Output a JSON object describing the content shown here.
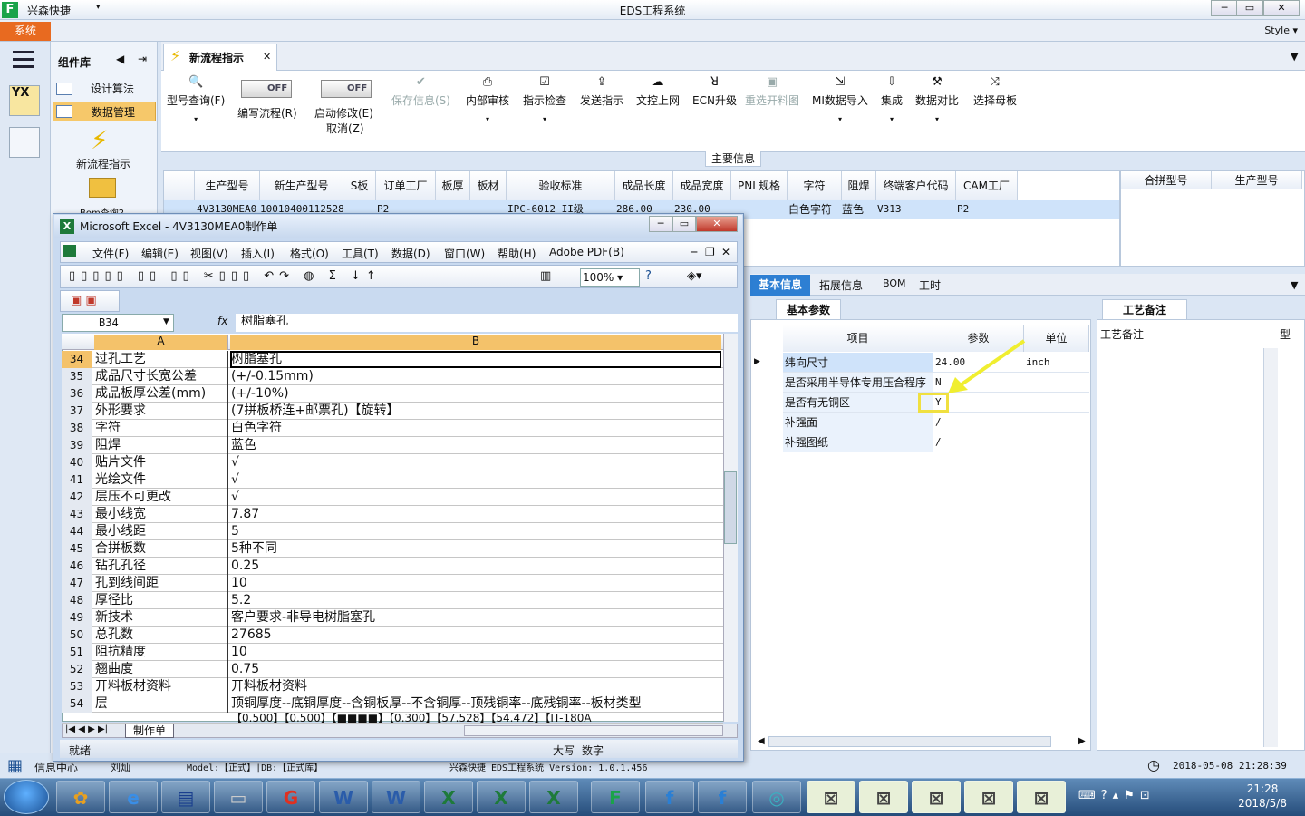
{
  "app": {
    "name": "兴森快捷",
    "window_title": "EDS工程系统",
    "system_menu": "系统",
    "style_label": "Style"
  },
  "component_panel": {
    "title": "组件库",
    "items": [
      {
        "label": "设计算法"
      },
      {
        "label": "数据管理"
      }
    ],
    "new_flow_label": "新流程指示",
    "bom_label": "Bom查询2"
  },
  "main_tab": {
    "label": "新流程指示"
  },
  "ribbon": {
    "buttons": [
      {
        "label": "型号查询(F)",
        "icon": "search-icon"
      },
      {
        "label": "编写流程(R)",
        "toggle": "OFF"
      },
      {
        "label": "启动修改(E)",
        "toggle": "OFF",
        "sub": "取消(Z)"
      },
      {
        "label": "保存信息(S)",
        "icon": "check-icon",
        "disabled": true
      },
      {
        "label": "内部审核",
        "icon": "print-icon"
      },
      {
        "label": "指示检查",
        "icon": "check-square-icon"
      },
      {
        "label": "发送指示",
        "icon": "upload-icon"
      },
      {
        "label": "文控上网",
        "icon": "cloud-upload-icon"
      },
      {
        "label": "ECN升级",
        "icon": "ecn-icon"
      },
      {
        "label": "重选开料图",
        "icon": "image-icon",
        "disabled": true
      },
      {
        "label": "MI数据导入",
        "icon": "import-icon"
      },
      {
        "label": "集成",
        "icon": "download-icon"
      },
      {
        "label": "数据对比",
        "icon": "compare-icon"
      },
      {
        "label": "选择母板",
        "icon": "shuffle-icon"
      }
    ],
    "section_label": "主要信息"
  },
  "main_grid": {
    "columns": [
      "生产型号",
      "新生产型号",
      "S板",
      "订单工厂",
      "板厚",
      "板材",
      "验收标准",
      "成品长度",
      "成品宽度",
      "PNL规格",
      "字符",
      "阻焊",
      "终端客户代码",
      "CAM工厂"
    ],
    "row": [
      "4V3130MEA0",
      "10010400112528",
      "P2",
      "",
      "",
      "",
      "IPC-6012 II级",
      "286.00",
      "230.00",
      "",
      "白色字符",
      "蓝色",
      "V313",
      "P2"
    ]
  },
  "side_grid": {
    "columns": [
      "合拼型号",
      "生产型号"
    ]
  },
  "lower_tabs": [
    "基本信息",
    "拓展信息",
    "BOM",
    "工时"
  ],
  "basic_params": {
    "tab_label": "基本参数",
    "columns": [
      "项目",
      "参数",
      "单位"
    ],
    "rows": [
      {
        "item": "纬向尺寸",
        "value": "24.00",
        "unit": "inch"
      },
      {
        "item": "是否采用半导体专用压合程序",
        "value": "N",
        "unit": ""
      },
      {
        "item": "是否有无铜区",
        "value": "Y",
        "unit": ""
      },
      {
        "item": "补强面",
        "value": "/",
        "unit": ""
      },
      {
        "item": "补强图纸",
        "value": "/",
        "unit": ""
      }
    ]
  },
  "process_notes": {
    "tab_label": "工艺备注",
    "column": "工艺备注",
    "column2": "型"
  },
  "status_bar": {
    "left": "信息中心",
    "user": "刘灿",
    "model": "Model:【正式】|DB:【正式库】",
    "center": "兴森快捷 EDS工程系统 Version: 1.0.1.456",
    "datetime": "2018-05-08 21:28:39"
  },
  "excel": {
    "title": "Microsoft Excel - 4V3130MEA0制作单",
    "menu": [
      "文件(F)",
      "编辑(E)",
      "视图(V)",
      "插入(I)",
      "格式(O)",
      "工具(T)",
      "数据(D)",
      "窗口(W)",
      "帮助(H)",
      "Adobe PDF(B)"
    ],
    "zoom": "100%",
    "name_box": "B34",
    "formula_icon": "fx",
    "formula": "树脂塞孔",
    "col_a": "A",
    "col_b": "B",
    "rows": [
      {
        "n": "34",
        "a": "过孔工艺",
        "b": "树脂塞孔"
      },
      {
        "n": "35",
        "a": "成品尺寸长宽公差",
        "b": "(+/-0.15mm)"
      },
      {
        "n": "36",
        "a": "成品板厚公差(mm)",
        "b": "(+/-10%)"
      },
      {
        "n": "37",
        "a": "外形要求",
        "b": "(7拼板桥连+邮票孔)【旋转】"
      },
      {
        "n": "38",
        "a": "字符",
        "b": "白色字符"
      },
      {
        "n": "39",
        "a": "阻焊",
        "b": "蓝色"
      },
      {
        "n": "40",
        "a": "贴片文件",
        "b": "√"
      },
      {
        "n": "41",
        "a": "光绘文件",
        "b": "√"
      },
      {
        "n": "42",
        "a": "层压不可更改",
        "b": "√"
      },
      {
        "n": "43",
        "a": "最小线宽",
        "b": "7.87"
      },
      {
        "n": "44",
        "a": "最小线距",
        "b": "5"
      },
      {
        "n": "45",
        "a": "合拼板数",
        "b": "5种不同"
      },
      {
        "n": "46",
        "a": "钻孔孔径",
        "b": "0.25"
      },
      {
        "n": "47",
        "a": "孔到线间距",
        "b": "10"
      },
      {
        "n": "48",
        "a": "厚径比",
        "b": "5.2"
      },
      {
        "n": "49",
        "a": "新技术",
        "b": "客户要求-非导电树脂塞孔"
      },
      {
        "n": "50",
        "a": "总孔数",
        "b": "27685"
      },
      {
        "n": "51",
        "a": "阻抗精度",
        "b": "10"
      },
      {
        "n": "52",
        "a": "翘曲度",
        "b": "0.75"
      },
      {
        "n": "53",
        "a": "开料板材资料",
        "b": "开料板材资料"
      },
      {
        "n": "54",
        "a": "层",
        "b": "顶铜厚度--底铜厚度--含铜板厚--不含铜厚--顶残铜率--底残铜率--板材类型"
      }
    ],
    "overflow_row": "【0.500】【0.500】【■■■■】【0.300】【57.528】【54.472】【IT-180A",
    "sheet_tab": "制作单",
    "status": "就绪",
    "caps": "大写",
    "num": "数字"
  },
  "taskbar": {
    "time": "21:28",
    "date": "2018/5/8"
  }
}
